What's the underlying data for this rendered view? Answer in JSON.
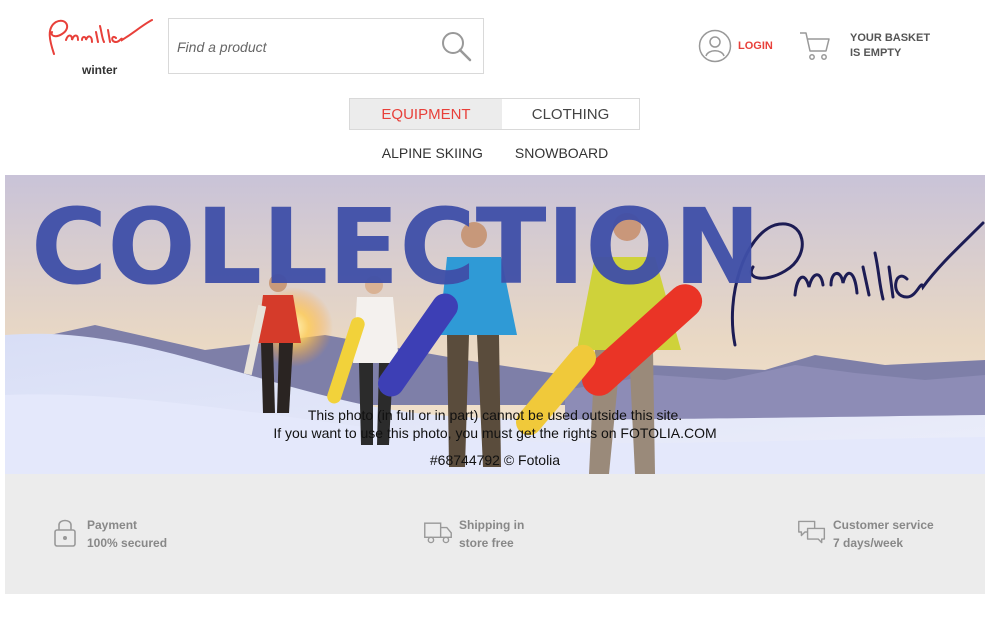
{
  "brand": {
    "logo_text": "Pricilia",
    "logo_sub": "winter",
    "accent_color": "#e8403a",
    "headline_color": "#3f4fa8"
  },
  "search": {
    "placeholder": "Find a product",
    "icon": "search-icon"
  },
  "account": {
    "login_label": "LOGIN",
    "icon": "user-icon"
  },
  "basket": {
    "line1": "YOUR BASKET",
    "line2": "IS EMPTY",
    "icon": "cart-icon"
  },
  "tabs": [
    {
      "label": "EQUIPMENT",
      "active": true
    },
    {
      "label": "CLOTHING",
      "active": false
    }
  ],
  "subnav": [
    {
      "label": "ALPINE SKIING"
    },
    {
      "label": "SNOWBOARD"
    }
  ],
  "banner": {
    "headline": "COLLECTION",
    "signature": "Pricilia",
    "watermark_line1": "This photo (in full or in part) cannot be used outside this site.",
    "watermark_line2": "If you want to use this photo, you must get the rights on FOTOLIA.COM",
    "watermark_id": "#68744792 © Fotolia"
  },
  "features": [
    {
      "line1": "Payment",
      "line2": "100% secured",
      "icon": "lock-icon"
    },
    {
      "line1": "Shipping in",
      "line2": "store free",
      "icon": "truck-icon"
    },
    {
      "line1": "Customer service",
      "line2": "7 days/week",
      "icon": "chat-icon"
    }
  ]
}
